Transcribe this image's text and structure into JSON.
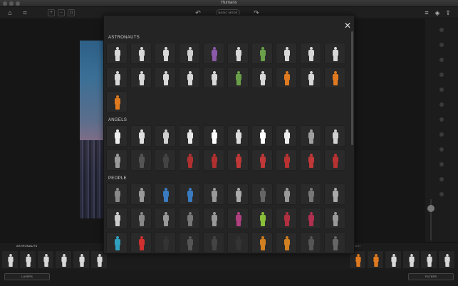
{
  "window": {
    "title": "Humans"
  },
  "toolbar": {
    "home_icon": "home-icon",
    "crop_icon": "crop-icon",
    "zoom_buttons": [
      "zoom-in-icon",
      "zoom-out-icon",
      "zoom-fit-icon"
    ],
    "undo_icon": "undo-icon",
    "redo_icon": "redo-icon",
    "mode_label": "BASIC MODE",
    "right_icons": [
      "list-icon",
      "layers-icon",
      "share-icon"
    ]
  },
  "modal": {
    "close_icon": "close-icon",
    "sections": [
      {
        "title": "ASTRONAUTS",
        "count": 21,
        "colors": [
          "#d8d8d8",
          "#d8d8d8",
          "#d8d8d8",
          "#cfcfcf",
          "#8a5aa8",
          "#d8d8d8",
          "#6aa04a",
          "#d8d8d8",
          "#d8d8d8",
          "#d8d8d8",
          "#d8d8d8",
          "#d8d8d8",
          "#d8d8d8",
          "#d8d8d8",
          "#d8d8d8",
          "#6aa04a",
          "#d8d8d8",
          "#e07a20",
          "#d8d8d8",
          "#e07a20",
          "#e07a20"
        ]
      },
      {
        "title": "ANGELS",
        "count": 20,
        "colors": [
          "#eeeeee",
          "#e0e0e0",
          "#d0d0d0",
          "#e8e8e8",
          "#ffffff",
          "#dcdcdc",
          "#ffffff",
          "#eeeeee",
          "#a0a0a0",
          "#d0d0d0",
          "#9a9a9a",
          "#555555",
          "#444444",
          "#b03030",
          "#b03030",
          "#c03838",
          "#c03838",
          "#b83232",
          "#c03838",
          "#b83232"
        ]
      },
      {
        "title": "PEOPLE",
        "count": 40,
        "colors": [
          "#888888",
          "#999999",
          "#3a7abf",
          "#3a7abf",
          "#999999",
          "#aaaaaa",
          "#666666",
          "#999999",
          "#777777",
          "#aaaaaa",
          "#cccccc",
          "#888888",
          "#999999",
          "#777777",
          "#999999",
          "#b04080",
          "#8abf3a",
          "#b03040",
          "#b03050",
          "#999999",
          "#30a0c0",
          "#d03030",
          "#333333",
          "#555555",
          "#444444",
          "#333333",
          "#d08020",
          "#d08020",
          "#555555",
          "#666666",
          "#111111",
          "#111111",
          "#111111",
          "#111111",
          "#111111",
          "#111111",
          "#111111",
          "#111111",
          "#111111",
          "#111111"
        ]
      }
    ]
  },
  "canvas": {
    "photo_alt": "city-skyline-photo"
  },
  "right_panel": {
    "items": [
      "item-1",
      "item-2",
      "item-3",
      "item-4",
      "item-5",
      "item-6",
      "item-7",
      "item-8",
      "item-9",
      "item-10",
      "item-11",
      "item-12"
    ]
  },
  "bottom_strip": {
    "title": "ASTRONAUTS",
    "title2": "NCH",
    "tiles_left": [
      "#d8d8d8",
      "#d8d8d8",
      "#d8d8d8",
      "#d8d8d8",
      "#d8d8d8",
      "#d8d8d8"
    ],
    "tiles_right": [
      "#e07a20",
      "#e07a20",
      "#d8d8d8",
      "#d8d8d8",
      "#d8d8d8",
      "#d8d8d8"
    ]
  },
  "footer": {
    "left_button": "LAYERS",
    "right_button": "FILTERS"
  }
}
